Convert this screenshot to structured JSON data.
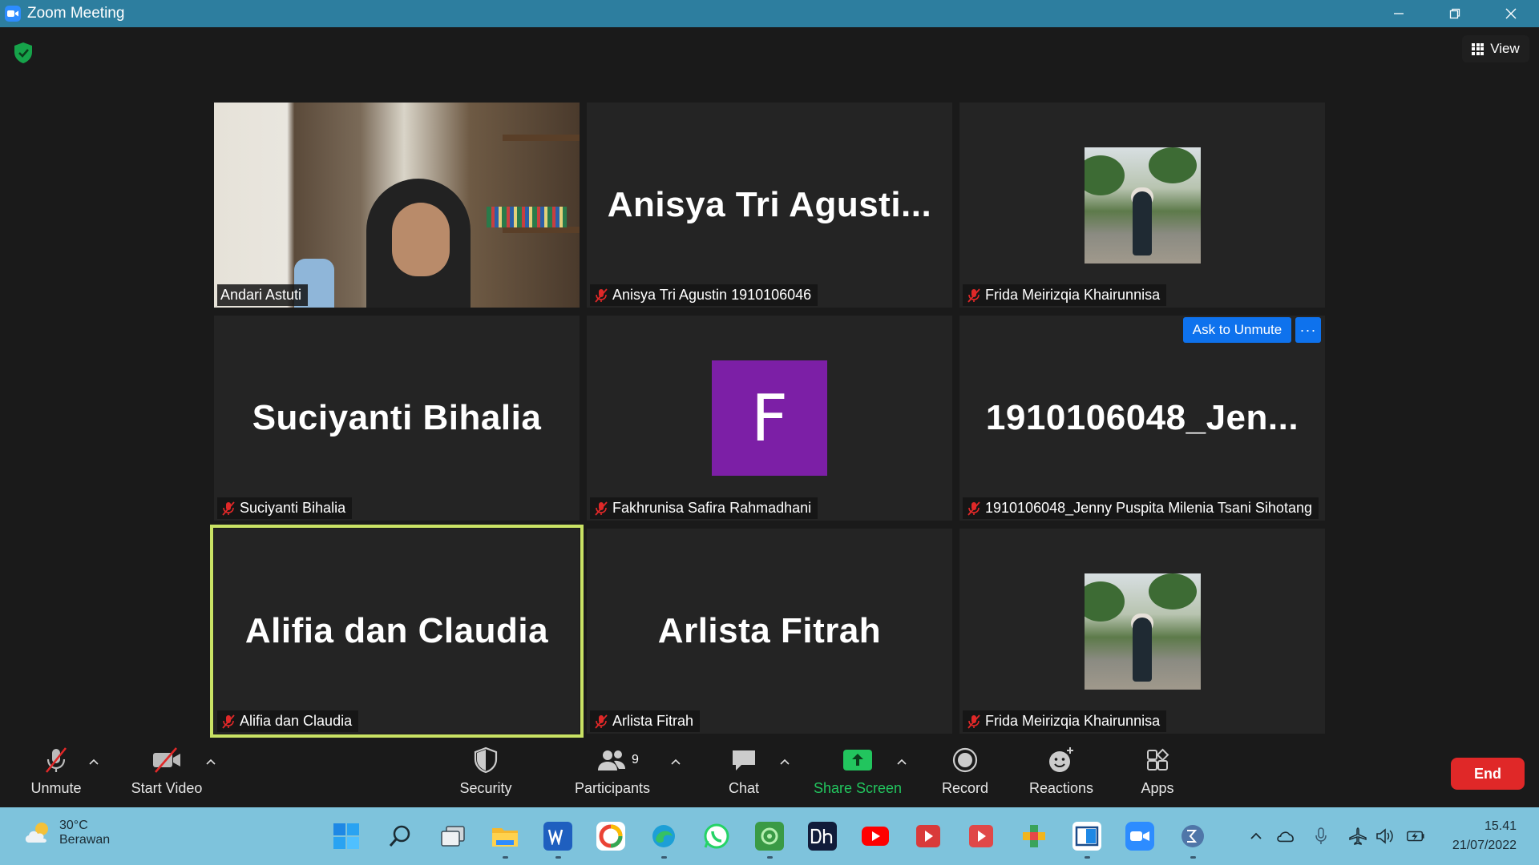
{
  "window": {
    "title": "Zoom Meeting"
  },
  "header": {
    "view_label": "View"
  },
  "tiles": [
    {
      "name": "Andari Astuti",
      "type": "video",
      "muted": false
    },
    {
      "name": "Anisya Tri Agustin 1910106046",
      "display": "Anisya Tri Agusti...",
      "type": "name",
      "muted": true
    },
    {
      "name": "Frida Meirizqia Khairunnisa",
      "type": "photo",
      "muted": true
    },
    {
      "name": "Suciyanti Bihalia",
      "display": "Suciyanti Bihalia",
      "type": "name",
      "muted": true
    },
    {
      "name": "Fakhrunisa Safira Rahmadhani",
      "initial": "F",
      "type": "avatar",
      "muted": true,
      "avatar_color": "#7c1fa6"
    },
    {
      "name": "1910106048_Jenny Puspita Milenia Tsani Sihotang",
      "display": "1910106048_Jen...",
      "type": "name",
      "muted": true
    },
    {
      "name": "Alifia dan Claudia",
      "display": "Alifia dan Claudia",
      "type": "name",
      "muted": true,
      "active_speaker": true
    },
    {
      "name": "Arlista Fitrah",
      "display": "Arlista Fitrah",
      "type": "name",
      "muted": true
    },
    {
      "name": "Frida Meirizqia Khairunnisa",
      "type": "photo",
      "muted": true
    }
  ],
  "hover_actions": {
    "ask_unmute": "Ask to Unmute",
    "more": "···"
  },
  "toolbar": {
    "unmute": "Unmute",
    "start_video": "Start Video",
    "security": "Security",
    "participants": "Participants",
    "participants_count": "9",
    "chat": "Chat",
    "share_screen": "Share Screen",
    "record": "Record",
    "reactions": "Reactions",
    "apps": "Apps",
    "end": "End"
  },
  "taskbar": {
    "weather_temp": "30°C",
    "weather_cond": "Berawan",
    "time": "15.41",
    "date": "21/07/2022"
  },
  "colors": {
    "titlebar": "#2d7e9f",
    "share_green": "#22c55e",
    "end_red": "#e02828",
    "unmute_blue": "#0e72ed",
    "active_outline": "#c9e264"
  }
}
